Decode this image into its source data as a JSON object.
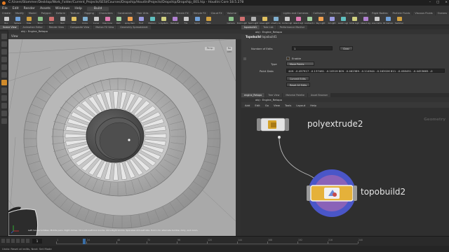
{
  "window": {
    "title": "C:/Users/Stammer/Desktop/Work_Folder/Current_Projects/SESI/Courses/Dropship/HoudiniProjects/Dropship/Dropship_001.hip - Houdini Core 18.5.278"
  },
  "menu": {
    "items": [
      "File",
      "Edit",
      "Render",
      "Assets",
      "Windows",
      "Help"
    ],
    "build_label": "Build"
  },
  "shelf": {
    "tabs_left": [
      "Create",
      "Modify",
      "Model",
      "Polygon",
      "Deform",
      "Texture",
      "Rigging",
      "Characters",
      "Constraints",
      "Hair Utils",
      "Guide Process",
      "Terrain FX",
      "Simple FX",
      "Cloud FX",
      "Volume"
    ],
    "tabs_right": [
      "Lights and Cameras",
      "Collisions",
      "Particles",
      "Grains",
      "Vellum",
      "Rigid Bodies",
      "Particle Fluids",
      "Viscous Fluids",
      "Oceans"
    ],
    "tools": [
      "Box",
      "Sphere",
      "Tube",
      "Torus",
      "Grid",
      "Null",
      "Line",
      "Circle",
      "Curve",
      "Draw Curve",
      "Path",
      "Spray Paint",
      "Font",
      "Platonic",
      "L-System",
      "Metaball",
      "File",
      "Spiral",
      "Helix"
    ],
    "tools_right": [
      "Camera",
      "Point Light",
      "Spot Light",
      "Area Light",
      "Geometry Light",
      "Volume Light",
      "Distant Light",
      "Environment Light",
      "Sky Light",
      "GI Light",
      "Caustic Light",
      "Portal Light",
      "Ambient Light",
      "Stereo Camera",
      "VR Camera",
      "Switcher"
    ]
  },
  "viewport_pane": {
    "tabs": [
      "Scene View",
      "Animation Editor",
      "Render View",
      "Composite View",
      "Motion FX View",
      "Geometry Spreadsheet"
    ],
    "path": [
      "obj",
      "Engine_Retopo"
    ],
    "header_label": "View",
    "badge_persp": "Persp",
    "badge_cam": "No cam",
    "status_hint": "Left mouse tumbles. Middle pans. Right dollies. Ctrl+Alt+Left box zooms. Ctrl+Right zooms. Spacebar-Ctrl-Left tilts. Hold L for alternate tumble, dolly, and zoom."
  },
  "parameter_pane": {
    "tabs": [
      "topobuild1",
      "Take List",
      "Performance Monitor"
    ],
    "path": [
      "obj",
      "Engine_Retopo"
    ],
    "node_type": "Topobuild",
    "node_name": "topobuild1",
    "number_of_edits_label": "Number of Edits",
    "number_of_edits_value": "1",
    "clear_label": "Clear",
    "enable_label": "Enable",
    "type_label": "Type",
    "type_value": "Move Points",
    "point_data_label": "Point Data",
    "point_data_value": "449, -0.457917, -0.137461, -0.10519 809, -0.462389, -0.114944, -0.163026 811, -0.458451, -0.4453665, -0",
    "commit_edits_label": "Commit Edits",
    "reset_all_label": "Reset All Edits"
  },
  "network_pane": {
    "tabs": [
      "engine_Retopo",
      "Tree View",
      "Material Palette",
      "Asset Browser"
    ],
    "path": [
      "obj",
      "Engine_Retopo"
    ],
    "menu": [
      "Add",
      "Edit",
      "Go",
      "View",
      "Tools",
      "Layout",
      "Help"
    ],
    "context_label": "Geometry",
    "nodes": [
      {
        "name": "polyextrude2"
      },
      {
        "name": "topobuild2"
      }
    ]
  },
  "timeline": {
    "current_frame": "1",
    "tick_labels": [
      "1",
      "24",
      "48",
      "72",
      "96",
      "120",
      "144",
      "168",
      "192",
      "216",
      "240"
    ],
    "end_frame": "240"
  },
  "status_bar": {
    "text": "Undo: Reset all edits, Next: Set Mode"
  },
  "colors": {
    "accent_orange": "#e57b22",
    "node_ring_blue": "#4a56c8",
    "node_ring_purple": "#8a62b8",
    "node_fill_yellow": "#e5b13a",
    "viewport_bg": "#a7a7a7"
  }
}
